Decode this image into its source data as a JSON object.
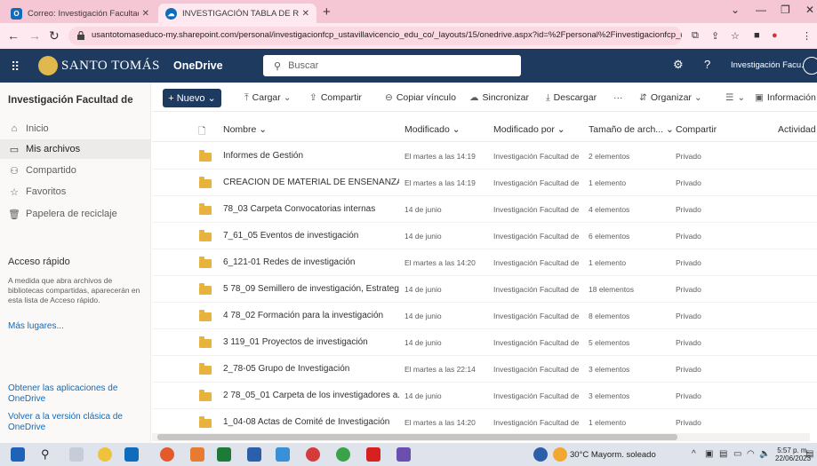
{
  "browser": {
    "tabs": [
      {
        "title": "Correo: Investigación Facultad de",
        "icon": "outlook-icon",
        "color": "#0f6cbd"
      },
      {
        "title": "INVESTIGACIÓN TABLA DE RETEN",
        "icon": "onedrive-icon",
        "color": "#0f6cbd"
      }
    ],
    "new_tab": "+",
    "url": "usantotomaseduco-my.sharepoint.com/personal/investigacionfcp_ustavillavicencio_edu_co/_layouts/15/onedrive.aspx?id=%2Fpersonal%2Finvestigacionfcp_ustavil..."
  },
  "suite": {
    "logo_text": "SANTO TOMÁS",
    "app_name": "OneDrive",
    "search_placeholder": "Buscar",
    "user_name": "Investigación Facu..."
  },
  "sidebar": {
    "title": "Investigación Facultad de",
    "items": [
      {
        "label": "Inicio",
        "icon": "home-icon"
      },
      {
        "label": "Mis archivos",
        "icon": "folder-icon",
        "selected": true
      },
      {
        "label": "Compartido",
        "icon": "people-icon"
      },
      {
        "label": "Favoritos",
        "icon": "star-icon"
      },
      {
        "label": "Papelera de reciclaje",
        "icon": "trash-icon"
      }
    ],
    "quick_access_title": "Acceso rápido",
    "quick_access_desc": "A medida que abra archivos de bibliotecas compartidas, aparecerán en esta lista de Acceso rápido.",
    "more_places": "Más lugares...",
    "get_apps": "Obtener las aplicaciones de OneDrive",
    "classic_view": "Volver a la versión clásica de OneDrive"
  },
  "toolbar": {
    "new_label": "+ Nuevo ⌄",
    "upload": "Cargar",
    "share": "Compartir",
    "copy_link": "Copiar vínculo",
    "sync": "Sincronizar",
    "download": "Descargar",
    "more": "···",
    "organize": "Organizar",
    "info": "Información"
  },
  "table": {
    "headers": {
      "name": "Nombre",
      "modified": "Modificado",
      "modified_by": "Modificado por",
      "size": "Tamaño de arch...",
      "sharing": "Compartir",
      "activity": "Actividad"
    },
    "rows": [
      {
        "name": "Informes de Gestión",
        "modified": "El martes a las 14:19",
        "modified_by": "Investigación Facultad de",
        "size": "2 elementos",
        "sharing": "Privado"
      },
      {
        "name": "CREACION DE MATERIAL DE ENSEÑANZA",
        "modified": "El martes a las 14:19",
        "modified_by": "Investigación Facultad de",
        "size": "1 elemento",
        "sharing": "Privado"
      },
      {
        "name": "78_03 Carpeta Convocatorias internas",
        "modified": "14 de junio",
        "modified_by": "Investigación Facultad de",
        "size": "4 elementos",
        "sharing": "Privado"
      },
      {
        "name": "7_61_05 Eventos de investigación",
        "modified": "14 de junio",
        "modified_by": "Investigación Facultad de",
        "size": "6 elementos",
        "sharing": "Privado"
      },
      {
        "name": "6_121-01 Redes de investigación",
        "modified": "El martes a las 14:20",
        "modified_by": "Investigación Facultad de",
        "size": "1 elemento",
        "sharing": "Privado"
      },
      {
        "name": "5 78_09 Semillero de investigación, Estrateg...",
        "modified": "14 de junio",
        "modified_by": "Investigación Facultad de",
        "size": "18 elementos",
        "sharing": "Privado"
      },
      {
        "name": "4 78_02 Formación para la investigación",
        "modified": "14 de junio",
        "modified_by": "Investigación Facultad de",
        "size": "8 elementos",
        "sharing": "Privado"
      },
      {
        "name": "3 119_01 Proyectos de investigación",
        "modified": "14 de junio",
        "modified_by": "Investigación Facultad de",
        "size": "5 elementos",
        "sharing": "Privado"
      },
      {
        "name": "2_78-05 Grupo de Investigación",
        "modified": "El martes a las 22:14",
        "modified_by": "Investigación Facultad de",
        "size": "3 elementos",
        "sharing": "Privado"
      },
      {
        "name": "2 78_05_01 Carpeta de los investigadores a...",
        "modified": "14 de junio",
        "modified_by": "Investigación Facultad de",
        "size": "3 elementos",
        "sharing": "Privado"
      },
      {
        "name": "1_04-08 Actas de Comité de Investigación",
        "modified": "El martes a las 14:20",
        "modified_by": "Investigación Facultad de",
        "size": "1 elemento",
        "sharing": "Privado"
      }
    ]
  },
  "taskbar": {
    "weather": "30°C Mayorm. soleado",
    "time": "5:57 p. m.",
    "date": "22/06/2023"
  },
  "colors": {
    "suite_bar": "#1e3a5f",
    "folder": "#e8b33c",
    "link": "#0f6cbd",
    "browser_tabs": "#f5c6d4"
  }
}
